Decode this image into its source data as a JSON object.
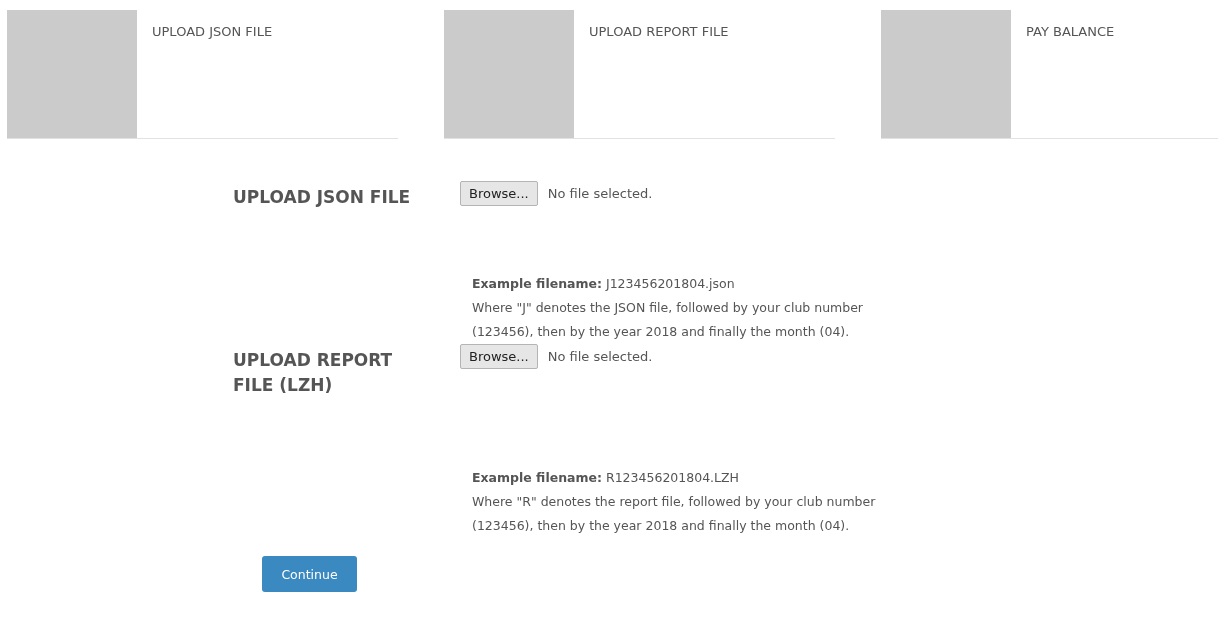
{
  "steps": [
    {
      "label": "UPLOAD JSON FILE"
    },
    {
      "label": "UPLOAD REPORT FILE"
    },
    {
      "label": "PAY BALANCE"
    }
  ],
  "fields": [
    {
      "label": "UPLOAD JSON FILE",
      "button": "Browse...",
      "status": "No file selected.",
      "example": "**Example filename:** J123456201804.json",
      "description": "Where \"J\" denotes the JSON file, followed by your club number (123456), then by the year 2018 and finally the month (04)."
    },
    {
      "label": "UPLOAD REPORT FILE (LZH)",
      "button": "Browse...",
      "status": "No file selected.",
      "example": "**Example filename:** R123456201804.LZH",
      "description": "Where \"R\" denotes the report file, followed by your club number (123456), then by the year 2018 and finally the month (04)."
    }
  ],
  "submit": "Continue"
}
